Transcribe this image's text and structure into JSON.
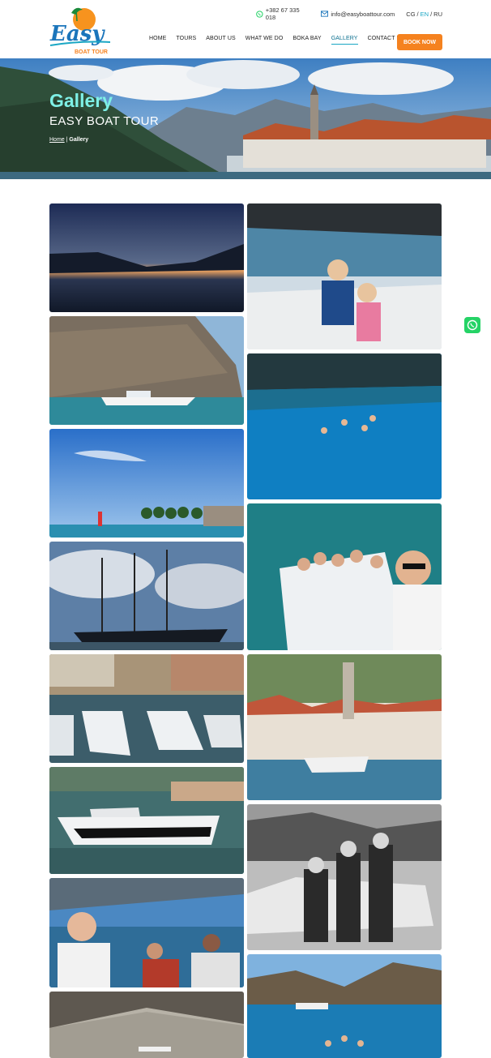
{
  "header": {
    "logo_text": "Easy",
    "logo_sub": "BOAT TOUR",
    "phone": "+382 67 335 018",
    "email": "info@easyboattour.com",
    "languages": [
      "CG",
      "EN",
      "RU"
    ],
    "active_language": "EN",
    "nav": [
      {
        "label": "HOME"
      },
      {
        "label": "TOURS"
      },
      {
        "label": "ABOUT US"
      },
      {
        "label": "WHAT WE DO"
      },
      {
        "label": "BOKA BAY"
      },
      {
        "label": "GALLERY"
      },
      {
        "label": "CONTACT US"
      }
    ],
    "book_button": "BOOK NOW"
  },
  "hero": {
    "title": "Gallery",
    "subtitle": "EASY BOAT TOUR",
    "breadcrumb_home": "Home",
    "breadcrumb_sep": " | ",
    "breadcrumb_current": "Gallery"
  },
  "colors": {
    "accent_orange": "#f5821f",
    "accent_teal": "#1aa7c4",
    "hero_title": "#7ef0e6",
    "whatsapp": "#25d366"
  },
  "gallery": [
    {
      "name": "sunset-bay"
    },
    {
      "name": "kids-on-boat"
    },
    {
      "name": "boat-near-cliff"
    },
    {
      "name": "swimmers-blue-water"
    },
    {
      "name": "lighthouse-palms"
    },
    {
      "name": "group-selfie-boat"
    },
    {
      "name": "sailing-yacht-masts"
    },
    {
      "name": "perast-town-boat"
    },
    {
      "name": "marina-boats"
    },
    {
      "name": "black-white-group"
    },
    {
      "name": "white-boat-marina"
    },
    {
      "name": "blue-cave-swimmers"
    },
    {
      "name": "selfie-on-deck"
    },
    {
      "name": "cave-rock"
    }
  ]
}
